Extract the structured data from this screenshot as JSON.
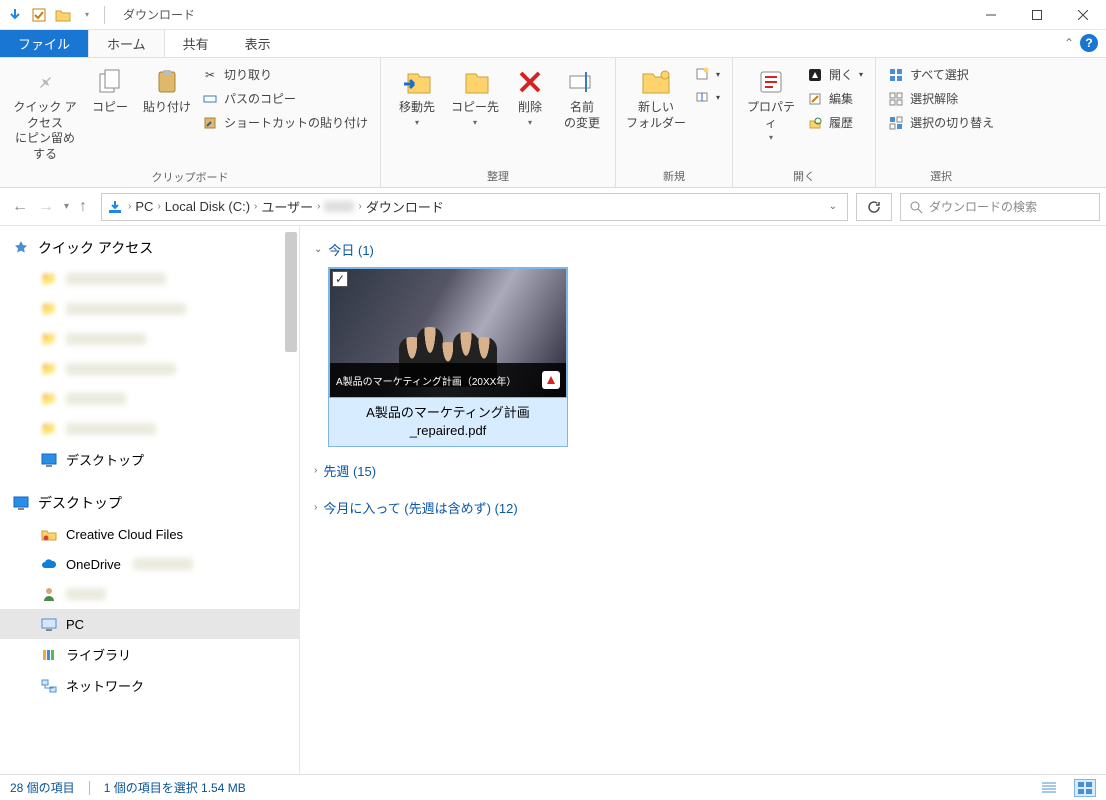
{
  "titlebar": {
    "title": "ダウンロード"
  },
  "tabs": {
    "file": "ファイル",
    "home": "ホーム",
    "share": "共有",
    "view": "表示"
  },
  "ribbon": {
    "clipboard": {
      "label": "クリップボード",
      "pin": "クイック アクセス\nにピン留めする",
      "copy": "コピー",
      "paste": "貼り付け",
      "cut": "切り取り",
      "copy_path": "パスのコピー",
      "paste_shortcut": "ショートカットの貼り付け"
    },
    "organize": {
      "label": "整理",
      "move_to": "移動先",
      "copy_to": "コピー先",
      "delete": "削除",
      "rename": "名前\nの変更"
    },
    "new": {
      "label": "新規",
      "new_folder": "新しい\nフォルダー"
    },
    "open": {
      "label": "開く",
      "properties": "プロパティ",
      "open": "開く",
      "edit": "編集",
      "history": "履歴"
    },
    "select": {
      "label": "選択",
      "select_all": "すべて選択",
      "select_none": "選択解除",
      "invert": "選択の切り替え"
    }
  },
  "breadcrumb": {
    "pc": "PC",
    "drive": "Local Disk (C:)",
    "users": "ユーザー",
    "folder": "ダウンロード"
  },
  "search": {
    "placeholder": "ダウンロードの検索"
  },
  "navpane": {
    "quick_access": "クイック アクセス",
    "desktop_qa": "デスクトップ",
    "desktop": "デスクトップ",
    "ccf": "Creative Cloud Files",
    "onedrive": "OneDrive",
    "pc": "PC",
    "library": "ライブラリ",
    "network": "ネットワーク"
  },
  "content": {
    "group_today": "今日 (1)",
    "group_lastweek": "先週 (15)",
    "group_month": "今月に入って (先週は含めず) (12)",
    "file1": {
      "overlay": "A製品のマーケティング計画（20XX年）",
      "name": "A製品のマーケティング計画_repaired.pdf"
    }
  },
  "statusbar": {
    "count": "28 個の項目",
    "selection": "1 個の項目を選択 1.54 MB"
  }
}
